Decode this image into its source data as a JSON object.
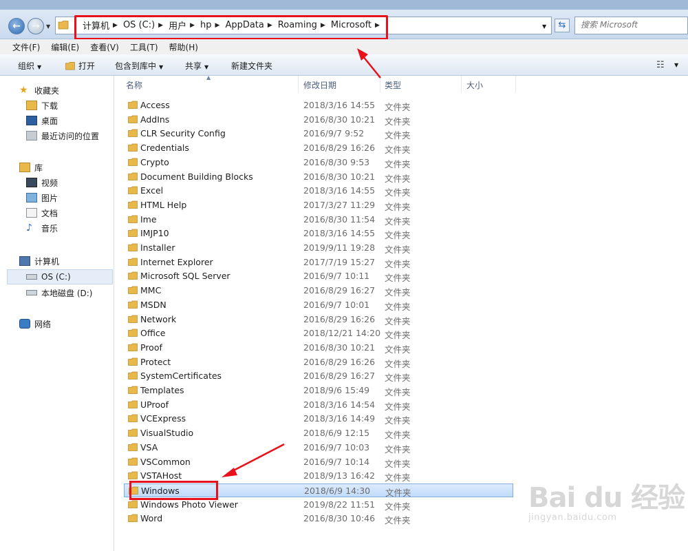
{
  "breadcrumb": [
    "计算机",
    "OS (C:)",
    "用户",
    "hp",
    "AppData",
    "Roaming",
    "Microsoft"
  ],
  "search": {
    "placeholder": "搜索 Microsoft"
  },
  "menu": [
    "文件(F)",
    "编辑(E)",
    "查看(V)",
    "工具(T)",
    "帮助(H)"
  ],
  "toolbar": {
    "organize": "组织",
    "open": "打开",
    "include_in_library": "包含到库中",
    "share": "共享",
    "new_folder": "新建文件夹"
  },
  "sidebar": {
    "favorites": {
      "label": "收藏夹",
      "items": [
        "下载",
        "桌面",
        "最近访问的位置"
      ]
    },
    "libraries": {
      "label": "库",
      "items": [
        "视频",
        "图片",
        "文档",
        "音乐"
      ]
    },
    "computer": {
      "label": "计算机",
      "items": [
        "OS (C:)",
        "本地磁盘 (D:)"
      ]
    },
    "network": {
      "label": "网络"
    }
  },
  "columns": {
    "name": "名称",
    "modified": "修改日期",
    "type": "类型",
    "size": "大小"
  },
  "files": [
    {
      "name": "Access",
      "date": "2018/3/16 14:55",
      "type": "文件夹"
    },
    {
      "name": "AddIns",
      "date": "2016/8/30 10:21",
      "type": "文件夹"
    },
    {
      "name": "CLR Security Config",
      "date": "2016/9/7 9:52",
      "type": "文件夹"
    },
    {
      "name": "Credentials",
      "date": "2016/8/29 16:26",
      "type": "文件夹"
    },
    {
      "name": "Crypto",
      "date": "2016/8/30 9:53",
      "type": "文件夹"
    },
    {
      "name": "Document Building Blocks",
      "date": "2016/8/30 10:21",
      "type": "文件夹"
    },
    {
      "name": "Excel",
      "date": "2018/3/16 14:55",
      "type": "文件夹"
    },
    {
      "name": "HTML Help",
      "date": "2017/3/27 11:29",
      "type": "文件夹"
    },
    {
      "name": "Ime",
      "date": "2016/8/30 11:54",
      "type": "文件夹"
    },
    {
      "name": "IMJP10",
      "date": "2018/3/16 14:55",
      "type": "文件夹"
    },
    {
      "name": "Installer",
      "date": "2019/9/11 19:28",
      "type": "文件夹"
    },
    {
      "name": "Internet Explorer",
      "date": "2017/7/19 15:27",
      "type": "文件夹"
    },
    {
      "name": "Microsoft SQL Server",
      "date": "2016/9/7 10:11",
      "type": "文件夹"
    },
    {
      "name": "MMC",
      "date": "2016/8/29 16:27",
      "type": "文件夹"
    },
    {
      "name": "MSDN",
      "date": "2016/9/7 10:01",
      "type": "文件夹"
    },
    {
      "name": "Network",
      "date": "2016/8/29 16:26",
      "type": "文件夹"
    },
    {
      "name": "Office",
      "date": "2018/12/21 14:20",
      "type": "文件夹"
    },
    {
      "name": "Proof",
      "date": "2016/8/30 10:21",
      "type": "文件夹"
    },
    {
      "name": "Protect",
      "date": "2016/8/29 16:26",
      "type": "文件夹"
    },
    {
      "name": "SystemCertificates",
      "date": "2016/8/29 16:27",
      "type": "文件夹"
    },
    {
      "name": "Templates",
      "date": "2018/9/6 15:49",
      "type": "文件夹"
    },
    {
      "name": "UProof",
      "date": "2018/3/16 14:54",
      "type": "文件夹"
    },
    {
      "name": "VCExpress",
      "date": "2018/3/16 14:49",
      "type": "文件夹"
    },
    {
      "name": "VisualStudio",
      "date": "2018/6/9 12:15",
      "type": "文件夹"
    },
    {
      "name": "VSA",
      "date": "2016/9/7 10:03",
      "type": "文件夹"
    },
    {
      "name": "VSCommon",
      "date": "2016/9/7 10:14",
      "type": "文件夹"
    },
    {
      "name": "VSTAHost",
      "date": "2018/9/13 16:42",
      "type": "文件夹"
    },
    {
      "name": "Windows",
      "date": "2018/6/9 14:30",
      "type": "文件夹",
      "selected": true
    },
    {
      "name": "Windows Photo Viewer",
      "date": "2019/8/22 11:51",
      "type": "文件夹"
    },
    {
      "name": "Word",
      "date": "2016/8/30 10:46",
      "type": "文件夹"
    }
  ],
  "watermark": {
    "main": "Bai du 经验",
    "sub": "jingyan.baidu.com"
  },
  "colors": {
    "highlight_red": "#e8101a",
    "selection": "#c1dbfa",
    "folder": "#e8b84a"
  }
}
